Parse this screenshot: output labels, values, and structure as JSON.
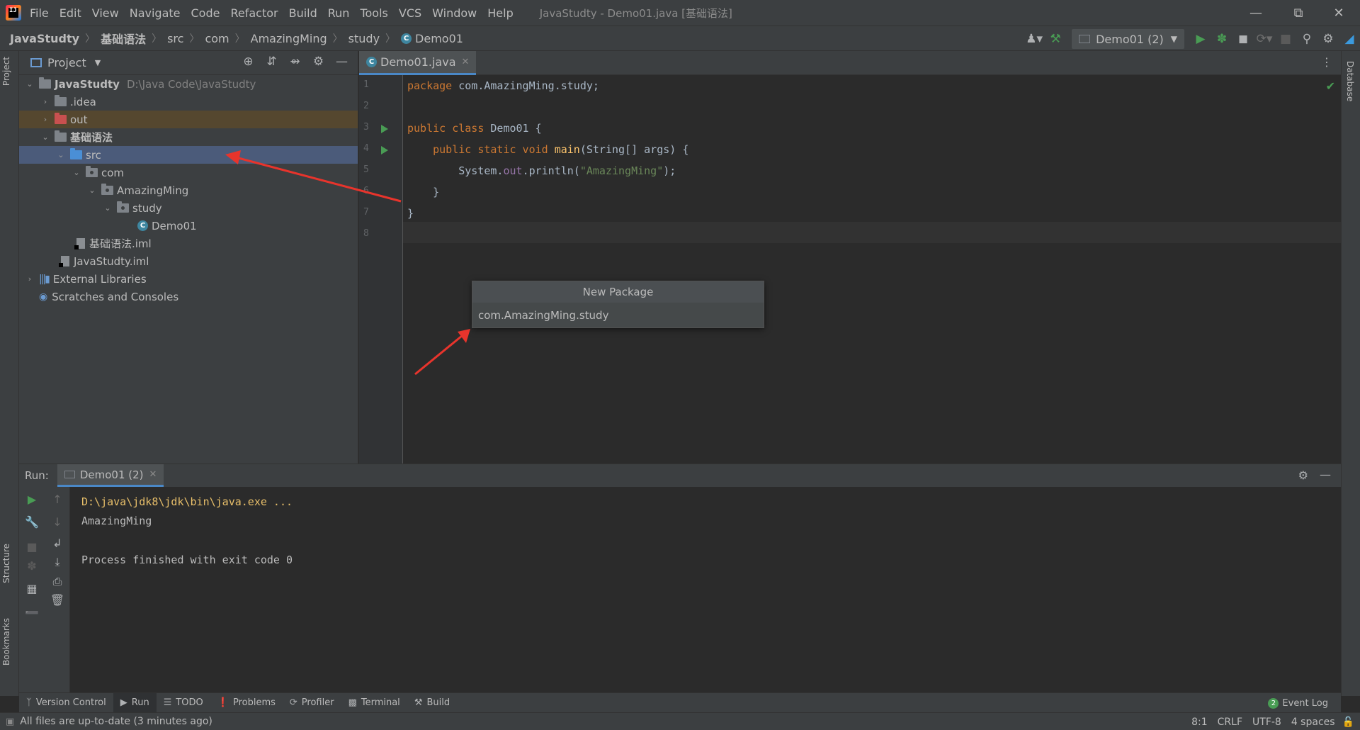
{
  "menu": {
    "items": [
      "File",
      "Edit",
      "View",
      "Navigate",
      "Code",
      "Refactor",
      "Build",
      "Run",
      "Tools",
      "VCS",
      "Window",
      "Help"
    ],
    "window_title": "JavaStudty - Demo01.java [基础语法]"
  },
  "breadcrumb": [
    "JavaStudty",
    "基础语法",
    "src",
    "com",
    "AmazingMing",
    "study",
    "Demo01"
  ],
  "toolbar": {
    "run_config": "Demo01 (2)"
  },
  "left_strip": {
    "project_tab": "Project",
    "structure_tab": "Structure",
    "bookmarks_tab": "Bookmarks"
  },
  "right_strip": {
    "database_tab": "Database"
  },
  "project": {
    "title": "Project",
    "root": {
      "label": "JavaStudty",
      "path": "D:\\Java Code\\JavaStudty"
    },
    "items": {
      "idea": ".idea",
      "out": "out",
      "module": "基础语法",
      "src": "src",
      "com": "com",
      "amazingming": "AmazingMing",
      "study": "study",
      "demo01": "Demo01",
      "module_iml": "基础语法.iml",
      "project_iml": "JavaStudty.iml",
      "external_libraries": "External Libraries",
      "scratches": "Scratches and Consoles"
    }
  },
  "editor": {
    "tab": "Demo01.java",
    "line_numbers": [
      "1",
      "2",
      "3",
      "4",
      "5",
      "6",
      "7",
      "8"
    ]
  },
  "popup": {
    "title": "New Package",
    "value": "com.AmazingMing.study"
  },
  "run_panel": {
    "label": "Run:",
    "tab": "Demo01 (2)",
    "console": {
      "command": "D:\\java\\jdk8\\jdk\\bin\\java.exe ...",
      "output": "AmazingMing",
      "exit": "Process finished with exit code 0"
    }
  },
  "toolwindows": {
    "version_control": "Version Control",
    "run": "Run",
    "todo": "TODO",
    "problems": "Problems",
    "profiler": "Profiler",
    "terminal": "Terminal",
    "build": "Build",
    "event_log": "Event Log",
    "event_log_count": "2"
  },
  "status": {
    "message": "All files are up-to-date (3 minutes ago)",
    "position": "8:1",
    "line_sep": "CRLF",
    "encoding": "UTF-8",
    "indent": "4 spaces"
  },
  "colors": {
    "annotation_arrow": "#e8342c",
    "accent": "#4a88c7",
    "run_green": "#499c54"
  }
}
